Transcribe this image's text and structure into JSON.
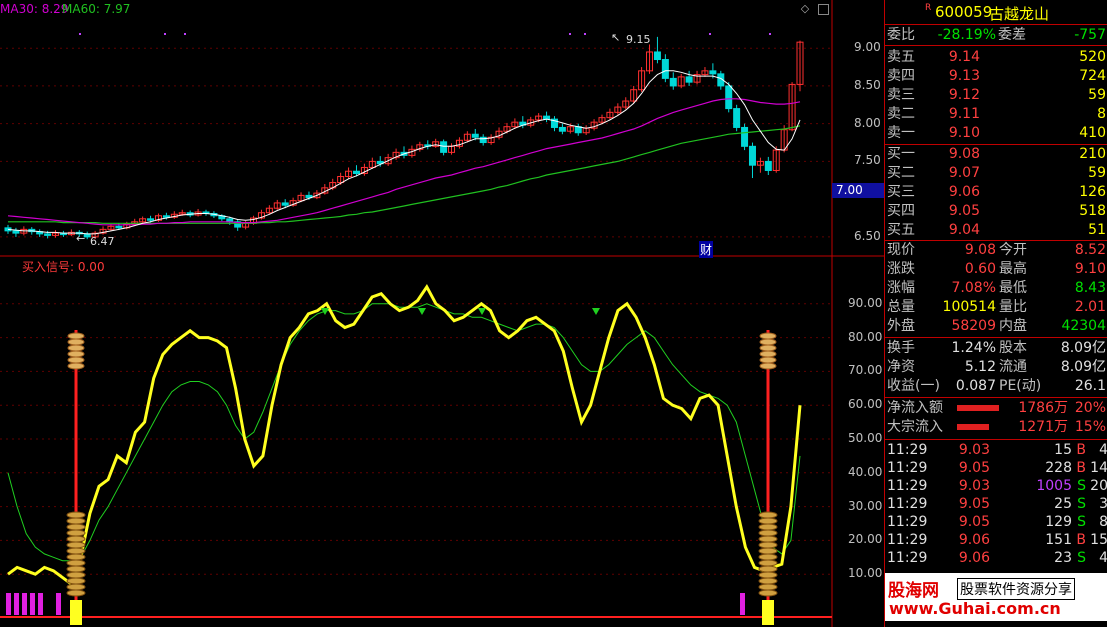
{
  "indicators": {
    "ma30": "MA30: 8.29",
    "ma60": "MA60: 7.97",
    "ind_label": "买入信号: 0.00",
    "high_mark": "9.15",
    "low_mark": "6.47",
    "cai_badge": "财",
    "current_price_tag": "7.00"
  },
  "price_axis": [
    "9.00",
    "8.50",
    "8.00",
    "7.50",
    "6.50"
  ],
  "ind_axis": [
    "90.00",
    "80.00",
    "70.00",
    "60.00",
    "50.00",
    "40.00",
    "30.00",
    "20.00",
    "10.00"
  ],
  "colors": {
    "up": "#ff3030",
    "down": "#00d8d8",
    "ma_white": "#ffffff",
    "ma_magenta": "#d000d0",
    "ma_green": "#20c020",
    "signal_yellow": "#ffff20",
    "signal_green": "#20d020"
  },
  "stock": {
    "r_mark": "R",
    "code": "600059",
    "name": "古越龙山"
  },
  "orderbook": {
    "weibi_label": "委比",
    "weibi": "-28.19%",
    "weicha_label": "委差",
    "weicha": "-757",
    "asks": [
      {
        "label": "卖五",
        "price": "9.14",
        "vol": "520"
      },
      {
        "label": "卖四",
        "price": "9.13",
        "vol": "724"
      },
      {
        "label": "卖三",
        "price": "9.12",
        "vol": "59"
      },
      {
        "label": "卖二",
        "price": "9.11",
        "vol": "8"
      },
      {
        "label": "卖一",
        "price": "9.10",
        "vol": "410"
      }
    ],
    "bids": [
      {
        "label": "买一",
        "price": "9.08",
        "vol": "210"
      },
      {
        "label": "买二",
        "price": "9.07",
        "vol": "59"
      },
      {
        "label": "买三",
        "price": "9.06",
        "vol": "126"
      },
      {
        "label": "买四",
        "price": "9.05",
        "vol": "518"
      },
      {
        "label": "买五",
        "price": "9.04",
        "vol": "51"
      }
    ]
  },
  "quote": [
    {
      "k1": "现价",
      "v1": "9.08",
      "k2": "今开",
      "v2": "8.52",
      "c1": "red",
      "c2": "red"
    },
    {
      "k1": "涨跌",
      "v1": "0.60",
      "k2": "最高",
      "v2": "9.10",
      "c1": "red",
      "c2": "red"
    },
    {
      "k1": "涨幅",
      "v1": "7.08%",
      "k2": "最低",
      "v2": "8.43",
      "c1": "red",
      "c2": "green"
    },
    {
      "k1": "总量",
      "v1": "100514",
      "k2": "量比",
      "v2": "2.01",
      "c1": "yellow",
      "c2": "red"
    },
    {
      "k1": "外盘",
      "v1": "58209",
      "k2": "内盘",
      "v2": "42304",
      "c1": "red",
      "c2": "green"
    }
  ],
  "fundamentals": [
    {
      "k1": "换手",
      "v1": "1.24%",
      "k2": "股本",
      "v2": "8.09亿"
    },
    {
      "k1": "净资",
      "v1": "5.12",
      "k2": "流通",
      "v2": "8.09亿"
    },
    {
      "k1": "收益(一)",
      "v1": "0.087",
      "k2": "PE(动)",
      "v2": "26.1"
    }
  ],
  "flows": [
    {
      "label": "净流入额",
      "amount": "1786万",
      "pct": "20%",
      "bar_fraction": 0.2
    },
    {
      "label": "大宗流入",
      "amount": "1271万",
      "pct": "15%",
      "bar_fraction": 0.15
    }
  ],
  "ticks": [
    {
      "time": "11:29",
      "price": "9.03",
      "vol": "15",
      "side": "B",
      "n": "4",
      "vcolor": "white"
    },
    {
      "time": "11:29",
      "price": "9.05",
      "vol": "228",
      "side": "B",
      "n": "14",
      "vcolor": "white"
    },
    {
      "time": "11:29",
      "price": "9.03",
      "vol": "1005",
      "side": "S",
      "n": "20",
      "vcolor": "purple"
    },
    {
      "time": "11:29",
      "price": "9.05",
      "vol": "25",
      "side": "S",
      "n": "3",
      "vcolor": "white"
    },
    {
      "time": "11:29",
      "price": "9.05",
      "vol": "129",
      "side": "S",
      "n": "8",
      "vcolor": "white"
    },
    {
      "time": "11:29",
      "price": "9.06",
      "vol": "151",
      "side": "B",
      "n": "15",
      "vcolor": "white"
    },
    {
      "time": "11:29",
      "price": "9.06",
      "vol": "23",
      "side": "S",
      "n": "4",
      "vcolor": "white"
    }
  ],
  "watermark": {
    "brand": "股海网",
    "slogan": "股票软件资源分享",
    "url": "www.Guhai.com.cn"
  },
  "chart_data": {
    "type": "candlestick+indicator",
    "price_range": [
      6.3,
      9.4
    ],
    "indicator_range": [
      0,
      100
    ],
    "candles": [
      [
        6.62,
        6.58,
        6.66,
        6.54
      ],
      [
        6.58,
        6.55,
        6.62,
        6.5
      ],
      [
        6.55,
        6.6,
        6.64,
        6.52
      ],
      [
        6.6,
        6.57,
        6.63,
        6.53
      ],
      [
        6.57,
        6.54,
        6.6,
        6.5
      ],
      [
        6.54,
        6.52,
        6.58,
        6.48
      ],
      [
        6.52,
        6.55,
        6.59,
        6.49
      ],
      [
        6.55,
        6.53,
        6.58,
        6.5
      ],
      [
        6.53,
        6.56,
        6.6,
        6.51
      ],
      [
        6.56,
        6.54,
        6.59,
        6.5
      ],
      [
        6.54,
        6.5,
        6.57,
        6.47
      ],
      [
        6.5,
        6.55,
        6.58,
        6.47
      ],
      [
        6.55,
        6.6,
        6.64,
        6.53
      ],
      [
        6.6,
        6.64,
        6.67,
        6.58
      ],
      [
        6.64,
        6.62,
        6.68,
        6.59
      ],
      [
        6.62,
        6.67,
        6.7,
        6.6
      ],
      [
        6.67,
        6.7,
        6.74,
        6.65
      ],
      [
        6.7,
        6.74,
        6.77,
        6.68
      ],
      [
        6.74,
        6.72,
        6.78,
        6.69
      ],
      [
        6.72,
        6.78,
        6.81,
        6.7
      ],
      [
        6.78,
        6.76,
        6.82,
        6.73
      ],
      [
        6.76,
        6.8,
        6.84,
        6.74
      ],
      [
        6.8,
        6.82,
        6.86,
        6.78
      ],
      [
        6.82,
        6.79,
        6.85,
        6.76
      ],
      [
        6.79,
        6.83,
        6.87,
        6.77
      ],
      [
        6.83,
        6.81,
        6.86,
        6.78
      ],
      [
        6.81,
        6.78,
        6.84,
        6.75
      ],
      [
        6.78,
        6.74,
        6.8,
        6.71
      ],
      [
        6.74,
        6.7,
        6.77,
        6.66
      ],
      [
        6.7,
        6.63,
        6.73,
        6.58
      ],
      [
        6.63,
        6.68,
        6.71,
        6.6
      ],
      [
        6.68,
        6.75,
        6.78,
        6.66
      ],
      [
        6.75,
        6.82,
        6.86,
        6.73
      ],
      [
        6.82,
        6.88,
        6.92,
        6.8
      ],
      [
        6.88,
        6.95,
        6.99,
        6.86
      ],
      [
        6.95,
        6.92,
        7.0,
        6.88
      ],
      [
        6.92,
        6.98,
        7.02,
        6.9
      ],
      [
        6.98,
        7.05,
        7.09,
        6.96
      ],
      [
        7.05,
        7.02,
        7.1,
        6.99
      ],
      [
        7.02,
        7.08,
        7.12,
        7.0
      ],
      [
        7.08,
        7.15,
        7.2,
        7.06
      ],
      [
        7.15,
        7.22,
        7.27,
        7.12
      ],
      [
        7.22,
        7.3,
        7.35,
        7.19
      ],
      [
        7.3,
        7.37,
        7.42,
        7.27
      ],
      [
        7.37,
        7.34,
        7.45,
        7.3
      ],
      [
        7.34,
        7.42,
        7.47,
        7.31
      ],
      [
        7.42,
        7.5,
        7.55,
        7.4
      ],
      [
        7.5,
        7.47,
        7.57,
        7.43
      ],
      [
        7.47,
        7.55,
        7.6,
        7.44
      ],
      [
        7.55,
        7.62,
        7.67,
        7.52
      ],
      [
        7.62,
        7.58,
        7.7,
        7.54
      ],
      [
        7.58,
        7.66,
        7.71,
        7.55
      ],
      [
        7.66,
        7.72,
        7.76,
        7.63
      ],
      [
        7.72,
        7.7,
        7.78,
        7.66
      ],
      [
        7.7,
        7.76,
        7.8,
        7.68
      ],
      [
        7.76,
        7.62,
        7.79,
        7.58
      ],
      [
        7.62,
        7.7,
        7.74,
        7.59
      ],
      [
        7.7,
        7.78,
        7.82,
        7.67
      ],
      [
        7.78,
        7.86,
        7.9,
        7.75
      ],
      [
        7.86,
        7.82,
        7.93,
        7.78
      ],
      [
        7.82,
        7.75,
        7.86,
        7.71
      ],
      [
        7.75,
        7.82,
        7.86,
        7.72
      ],
      [
        7.82,
        7.9,
        7.95,
        7.79
      ],
      [
        7.9,
        7.96,
        8.01,
        7.87
      ],
      [
        7.96,
        8.02,
        8.07,
        7.93
      ],
      [
        8.02,
        7.98,
        8.1,
        7.94
      ],
      [
        7.98,
        8.05,
        8.09,
        7.95
      ],
      [
        8.05,
        8.1,
        8.14,
        8.02
      ],
      [
        8.1,
        8.06,
        8.16,
        8.02
      ],
      [
        8.06,
        7.95,
        8.1,
        7.9
      ],
      [
        7.95,
        7.9,
        8.0,
        7.86
      ],
      [
        7.9,
        7.96,
        8.0,
        7.87
      ],
      [
        7.96,
        7.88,
        8.0,
        7.84
      ],
      [
        7.88,
        7.94,
        7.98,
        7.85
      ],
      [
        7.94,
        8.02,
        8.06,
        7.91
      ],
      [
        8.02,
        8.08,
        8.12,
        7.99
      ],
      [
        8.08,
        8.15,
        8.2,
        8.05
      ],
      [
        8.15,
        8.22,
        8.27,
        8.12
      ],
      [
        8.22,
        8.3,
        8.35,
        8.19
      ],
      [
        8.3,
        8.45,
        8.5,
        8.27
      ],
      [
        8.45,
        8.7,
        8.75,
        8.42
      ],
      [
        8.7,
        8.95,
        9.05,
        8.66
      ],
      [
        8.95,
        8.85,
        9.15,
        8.8
      ],
      [
        8.85,
        8.6,
        8.92,
        8.55
      ],
      [
        8.6,
        8.5,
        8.68,
        8.45
      ],
      [
        8.5,
        8.62,
        8.66,
        8.47
      ],
      [
        8.62,
        8.55,
        8.7,
        8.5
      ],
      [
        8.55,
        8.65,
        8.7,
        8.52
      ],
      [
        8.65,
        8.7,
        8.75,
        8.62
      ],
      [
        8.7,
        8.66,
        8.8,
        8.6
      ],
      [
        8.66,
        8.5,
        8.7,
        8.45
      ],
      [
        8.5,
        8.2,
        8.55,
        8.15
      ],
      [
        8.2,
        7.95,
        8.25,
        7.9
      ],
      [
        7.95,
        7.7,
        8.0,
        7.65
      ],
      [
        7.7,
        7.45,
        7.75,
        7.28
      ],
      [
        7.45,
        7.5,
        7.55,
        7.35
      ],
      [
        7.5,
        7.38,
        7.56,
        7.32
      ],
      [
        7.38,
        7.65,
        7.7,
        7.35
      ],
      [
        7.65,
        7.92,
        7.98,
        7.62
      ],
      [
        7.92,
        8.52,
        8.55,
        7.9
      ],
      [
        8.52,
        9.08,
        9.1,
        8.43
      ]
    ],
    "ma_white": [
      6.6,
      6.59,
      6.58,
      6.58,
      6.57,
      6.56,
      6.56,
      6.55,
      6.55,
      6.55,
      6.54,
      6.54,
      6.56,
      6.58,
      6.6,
      6.62,
      6.65,
      6.68,
      6.7,
      6.73,
      6.75,
      6.77,
      6.79,
      6.8,
      6.81,
      6.81,
      6.8,
      6.78,
      6.76,
      6.73,
      6.72,
      6.73,
      6.76,
      6.8,
      6.85,
      6.89,
      6.93,
      6.97,
      7.01,
      7.05,
      7.1,
      7.15,
      7.21,
      7.27,
      7.31,
      7.36,
      7.41,
      7.46,
      7.51,
      7.56,
      7.6,
      7.63,
      7.67,
      7.7,
      7.72,
      7.7,
      7.7,
      7.72,
      7.76,
      7.8,
      7.8,
      7.81,
      7.84,
      7.89,
      7.94,
      7.98,
      8.01,
      8.04,
      8.06,
      8.04,
      8.01,
      7.98,
      7.96,
      7.94,
      7.96,
      8.0,
      8.05,
      8.11,
      8.18,
      8.27,
      8.4,
      8.55,
      8.65,
      8.7,
      8.7,
      8.68,
      8.65,
      8.63,
      8.63,
      8.63,
      8.6,
      8.52,
      8.4,
      8.25,
      8.05,
      7.9,
      7.75,
      7.66,
      7.65,
      7.8,
      8.05
    ],
    "ma_magenta": [
      6.78,
      6.77,
      6.76,
      6.75,
      6.74,
      6.73,
      6.72,
      6.71,
      6.7,
      6.69,
      6.68,
      6.67,
      6.66,
      6.66,
      6.66,
      6.66,
      6.66,
      6.67,
      6.67,
      6.68,
      6.68,
      6.69,
      6.69,
      6.7,
      6.7,
      6.7,
      6.7,
      6.7,
      6.7,
      6.69,
      6.69,
      6.69,
      6.7,
      6.71,
      6.72,
      6.74,
      6.76,
      6.78,
      6.8,
      6.82,
      6.85,
      6.88,
      6.91,
      6.94,
      6.97,
      7.0,
      7.03,
      7.06,
      7.09,
      7.13,
      7.16,
      7.19,
      7.22,
      7.25,
      7.28,
      7.3,
      7.32,
      7.35,
      7.38,
      7.41,
      7.43,
      7.46,
      7.49,
      7.52,
      7.55,
      7.58,
      7.61,
      7.64,
      7.67,
      7.69,
      7.71,
      7.73,
      7.75,
      7.77,
      7.79,
      7.81,
      7.84,
      7.87,
      7.9,
      7.93,
      7.97,
      8.02,
      8.07,
      8.11,
      8.15,
      8.18,
      8.21,
      8.24,
      8.27,
      8.3,
      8.32,
      8.33,
      8.33,
      8.32,
      8.3,
      8.28,
      8.27,
      8.26,
      8.26,
      8.27,
      8.29
    ],
    "ma_green": [
      6.7,
      6.7,
      6.7,
      6.7,
      6.7,
      6.7,
      6.7,
      6.69,
      6.69,
      6.69,
      6.69,
      6.69,
      6.68,
      6.68,
      6.68,
      6.68,
      6.68,
      6.68,
      6.68,
      6.68,
      6.68,
      6.68,
      6.68,
      6.68,
      6.68,
      6.68,
      6.68,
      6.68,
      6.68,
      6.68,
      6.68,
      6.68,
      6.69,
      6.69,
      6.7,
      6.7,
      6.71,
      6.72,
      6.73,
      6.74,
      6.75,
      6.76,
      6.77,
      6.79,
      6.8,
      6.82,
      6.83,
      6.85,
      6.87,
      6.89,
      6.91,
      6.93,
      6.95,
      6.97,
      6.99,
      7.01,
      7.03,
      7.05,
      7.07,
      7.09,
      7.11,
      7.13,
      7.16,
      7.18,
      7.21,
      7.24,
      7.27,
      7.29,
      7.32,
      7.34,
      7.36,
      7.38,
      7.4,
      7.42,
      7.44,
      7.46,
      7.48,
      7.5,
      7.53,
      7.56,
      7.59,
      7.62,
      7.65,
      7.68,
      7.71,
      7.74,
      7.76,
      7.78,
      7.8,
      7.82,
      7.84,
      7.86,
      7.87,
      7.88,
      7.89,
      7.9,
      7.91,
      7.92,
      7.93,
      7.95,
      7.97
    ],
    "signal_yellow": [
      10,
      12,
      11,
      10,
      12,
      11,
      9,
      7,
      15,
      28,
      36,
      38,
      45,
      43,
      52,
      55,
      68,
      75,
      78,
      80,
      82,
      80,
      80,
      79,
      77,
      65,
      50,
      42,
      45,
      60,
      72,
      80,
      83,
      87,
      88,
      90,
      85,
      83,
      84,
      88,
      92,
      93,
      90,
      88,
      89,
      91,
      95,
      90,
      88,
      85,
      86,
      88,
      90,
      88,
      82,
      80,
      82,
      85,
      86,
      84,
      82,
      76,
      65,
      55,
      60,
      70,
      80,
      88,
      90,
      86,
      80,
      72,
      62,
      60,
      59,
      56,
      62,
      63,
      60,
      45,
      30,
      18,
      12,
      11,
      12,
      13,
      30,
      60
    ],
    "signal_green": [
      40,
      30,
      22,
      18,
      16,
      15,
      14,
      14,
      15,
      20,
      26,
      30,
      35,
      40,
      45,
      50,
      55,
      60,
      64,
      66,
      67,
      67,
      66,
      64,
      60,
      54,
      50,
      52,
      58,
      65,
      72,
      78,
      82,
      85,
      87,
      88,
      88,
      87,
      87,
      88,
      90,
      90,
      90,
      89,
      89,
      89,
      90,
      89,
      88,
      87,
      87,
      86,
      86,
      85,
      84,
      83,
      82,
      83,
      84,
      84,
      83,
      80,
      76,
      72,
      70,
      70,
      72,
      75,
      78,
      80,
      82,
      80,
      76,
      72,
      69,
      66,
      64,
      63,
      62,
      60,
      55,
      45,
      35,
      25,
      18,
      16,
      20,
      45
    ]
  }
}
